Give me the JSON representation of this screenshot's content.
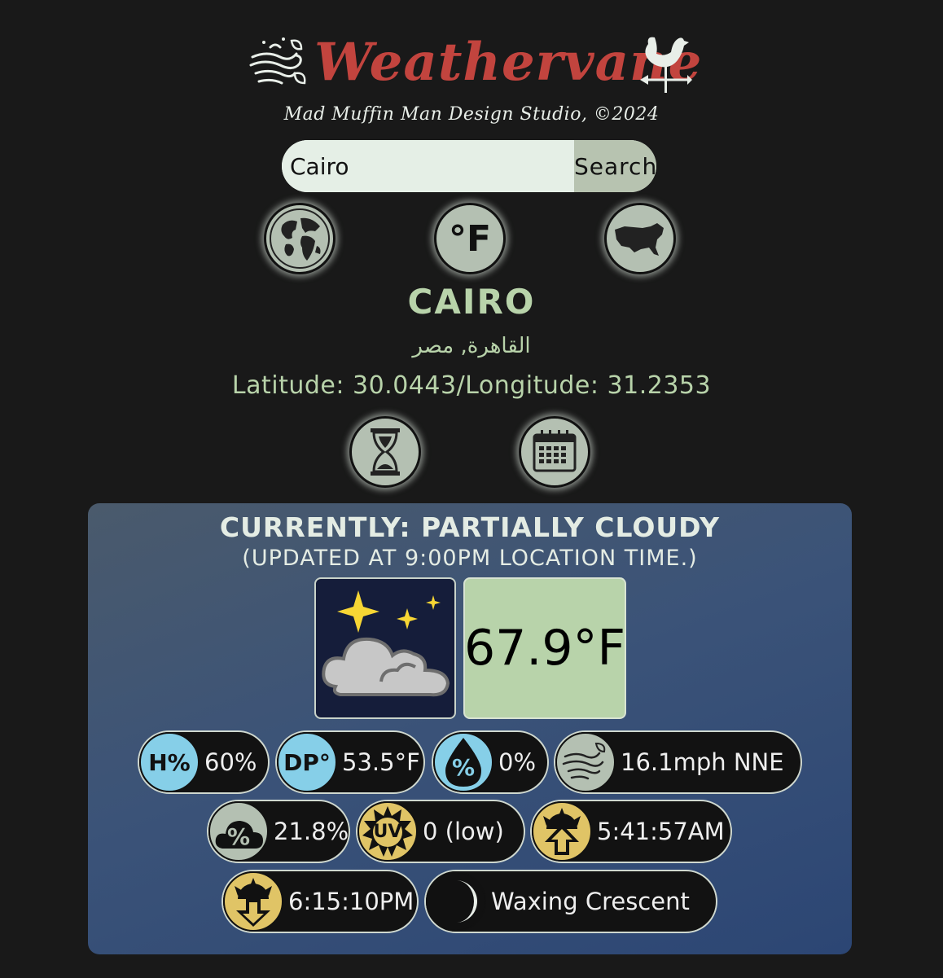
{
  "header": {
    "brand": "Weathervane",
    "studio": "Mad Muffin Man Design Studio, ©2024"
  },
  "search": {
    "value": "Cairo",
    "placeholder": "",
    "button_label": "Search"
  },
  "controls": {
    "unit_label": "°F"
  },
  "location": {
    "city": "CAIRO",
    "native": "القاهرة, مصر",
    "coords": "Latitude: 30.0443/Longitude: 31.2353"
  },
  "current": {
    "heading": "CURRENTLY: PARTIALLY CLOUDY",
    "updated": "(UPDATED AT 9:00PM LOCATION TIME.)",
    "temperature": "67.9°F",
    "humidity_badge": "H%",
    "humidity": "60%",
    "dewpoint_badge": "DP°",
    "dewpoint": "53.5°F",
    "precip_badge": "%",
    "precip": "0%",
    "wind": "16.1mph NNE",
    "cloud_badge": "%",
    "cloud": "21.8%",
    "uv_badge": "UV",
    "uv": "0 (low)",
    "sunrise": "5:41:57AM",
    "sunset": "6:15:10PM",
    "moon": "Waxing Crescent"
  },
  "colors": {
    "background": "#191919",
    "accent": "#b8d3aa",
    "brand": "#c2443e",
    "badge_blue": "#86cfe8",
    "badge_sage": "#b4c0b2",
    "badge_gold": "#e0c466"
  }
}
